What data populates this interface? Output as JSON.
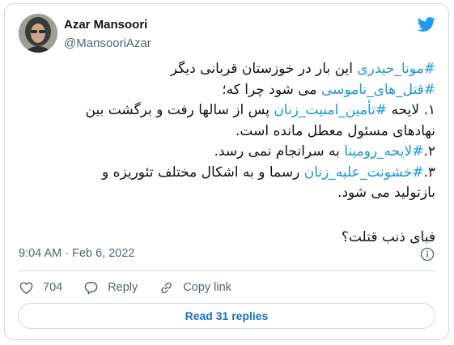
{
  "author": {
    "name": "Azar Mansoori",
    "handle": "@MansooriAzar"
  },
  "tweet": {
    "line1": {
      "hashtag": "#مونا_حیدری",
      "text": " این بار در خوزستان قربانی دیگر"
    },
    "line2": {
      "hashtag": "#قتل_های_ناموسی",
      "text": " می شود چرا که؛"
    },
    "line3": {
      "prefix": "۱. لایحه ",
      "hashtag": "#تأمین_امنیت_زنان",
      "text": " پس از سالها رفت و برگشت بین"
    },
    "line4": {
      "text": "نهادهای مسئول معطل مانده است."
    },
    "line5": {
      "prefix": "۲.",
      "hashtag": "#لایحه_رومینا",
      "text": " به سرانجام نمی رسد."
    },
    "line6": {
      "prefix": "۳.",
      "hashtag": "#خشونت_علیه_زنان",
      "text": " رسما و به اشکال مختلف تئوریزه و"
    },
    "line7": {
      "text": "بازتولید می شود."
    },
    "line8": {
      "text": "فبای ذنب قتلت؟"
    }
  },
  "meta": {
    "timestamp": "9:04 AM · Feb 6, 2022"
  },
  "actions": {
    "likes": "704",
    "reply_label": "Reply",
    "copy_label": "Copy link"
  },
  "replies_button": "Read 31 replies",
  "colors": {
    "accent": "#1d9bf0",
    "hashtag": "#1b95e0",
    "muted": "#536471",
    "border": "#cfd9de"
  },
  "icons": [
    "twitter-bird-icon",
    "info-icon",
    "heart-icon",
    "reply-icon",
    "link-icon"
  ]
}
